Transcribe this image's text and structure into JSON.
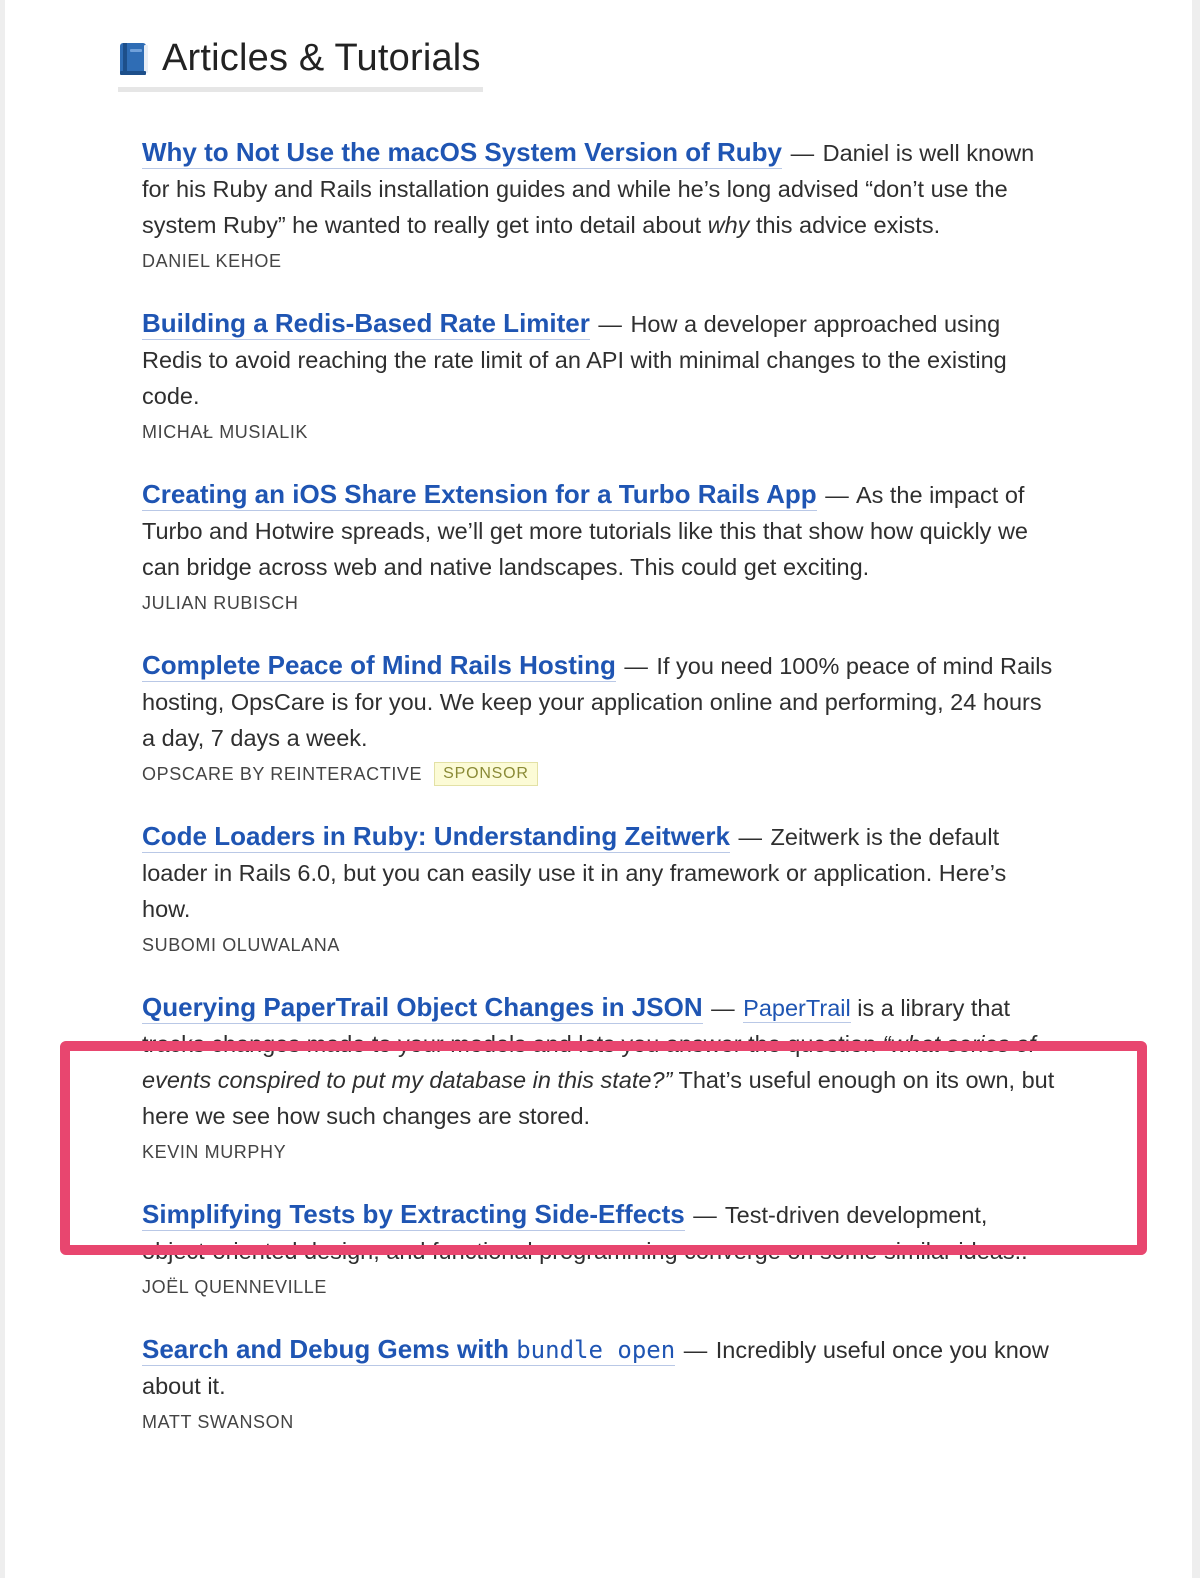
{
  "section": {
    "icon": "blue-book-icon",
    "title": "Articles & Tutorials"
  },
  "articles": [
    {
      "title": "Why to Not Use the macOS System Version of Ruby",
      "dash": "—",
      "desc_1": "Daniel is well known for his Ruby and Rails installation guides and while he’s long advised “don’t use the system Ruby” he wanted to really get into detail about",
      "desc_em": "why",
      "desc_2": "this advice exists.",
      "author": "DANIEL KEHOE"
    },
    {
      "title": "Building a Redis-Based Rate Limiter",
      "dash": "—",
      "desc": "How a developer approached using Redis to avoid reaching the rate limit of an API with minimal changes to the existing code.",
      "author": "MICHAŁ MUSIALIK"
    },
    {
      "title": "Creating an iOS Share Extension for a Turbo Rails App",
      "dash": "—",
      "desc": "As the impact of Turbo and Hotwire spreads, we’ll get more tutorials like this that show how quickly we can bridge across web and native landscapes. This could get exciting.",
      "author": "JULIAN RUBISCH"
    },
    {
      "title": "Complete Peace of Mind Rails Hosting",
      "dash": "—",
      "desc": "If you need 100% peace of mind Rails hosting, OpsCare is for you. We keep your application online and performing, 24 hours a day, 7 days a week.",
      "author": "OPSCARE BY REINTERACTIVE",
      "badge": "SPONSOR"
    },
    {
      "title": "Code Loaders in Ruby: Understanding Zeitwerk",
      "dash": "—",
      "desc": "Zeitwerk is the default loader in Rails 6.0, but you can easily use it in any framework or application. Here’s how.",
      "author": "SUBOMI OLUWALANA"
    },
    {
      "title": "Querying PaperTrail Object Changes in JSON",
      "dash": "—",
      "inline_link": "PaperTrail",
      "desc_1": "is a library that tracks changes made to your models and lets you answer the question",
      "desc_em": "“what series of events conspired to put my database in this state?”",
      "desc_2": "That’s useful enough on its own, but here we see how such changes are stored.",
      "author": "KEVIN MURPHY"
    },
    {
      "title": "Simplifying Tests by Extracting Side-Effects",
      "dash": "—",
      "desc": "Test-driven development, object-oriented design, and functional programming converge on some similar ideas..",
      "author": "JOËL QUENNEVILLE"
    },
    {
      "title_text": "Search and Debug Gems with",
      "title_code": "bundle open",
      "dash": "—",
      "desc": "Incredibly useful once you know about it.",
      "author": "MATT SWANSON"
    }
  ],
  "colors": {
    "link": "#1f55b3",
    "highlight_border": "#e8466f",
    "sponsor_bg": "#fcfbd6"
  }
}
